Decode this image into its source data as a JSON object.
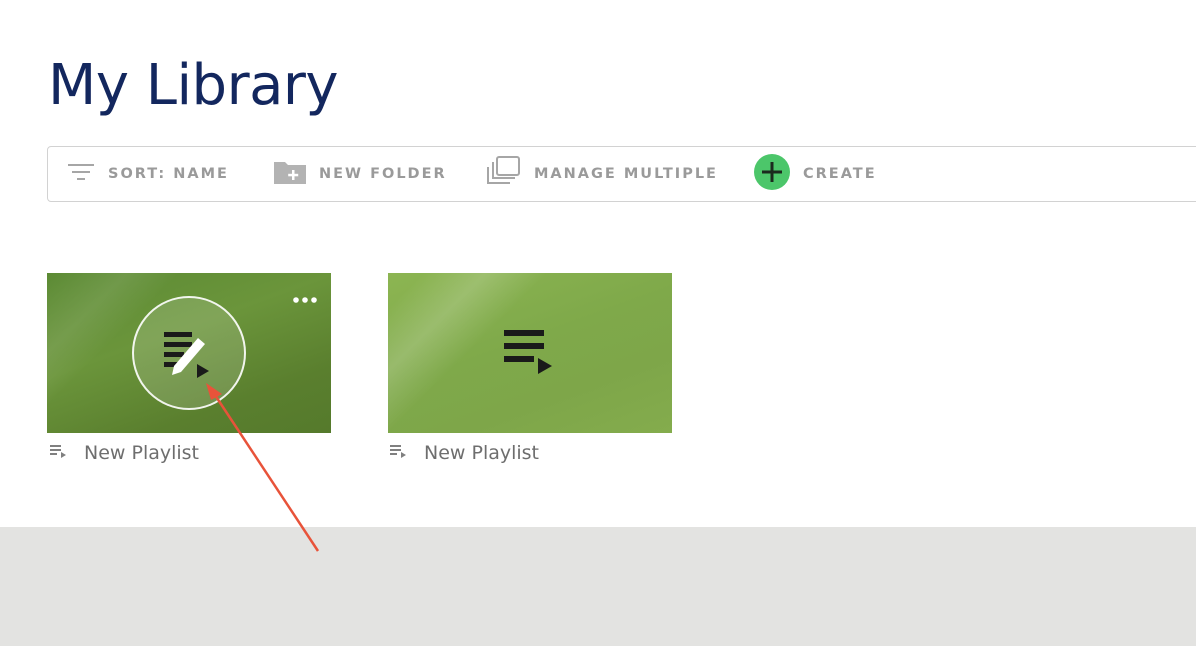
{
  "page": {
    "title": "My Library"
  },
  "toolbar": {
    "sort_label": "SORT: NAME",
    "new_folder_label": "NEW FOLDER",
    "manage_multiple_label": "MANAGE MULTIPLE",
    "create_label": "CREATE"
  },
  "icons": {
    "sort": "sort-icon",
    "new_folder": "folder-plus-icon",
    "manage_multiple": "multiple-copy-icon",
    "create": "plus-circle-icon",
    "edit_playlist": "edit-playlist-icon",
    "playlist": "playlist-icon",
    "more": "more-horizontal-icon"
  },
  "colors": {
    "title": "#13275e",
    "create_accent": "#4cc66a",
    "toolbar_text": "#9a9a9a",
    "footer_band": "#e3e3e1",
    "annotation_arrow": "#e8533a"
  },
  "items": [
    {
      "name": "New Playlist"
    },
    {
      "name": "New Playlist"
    }
  ]
}
